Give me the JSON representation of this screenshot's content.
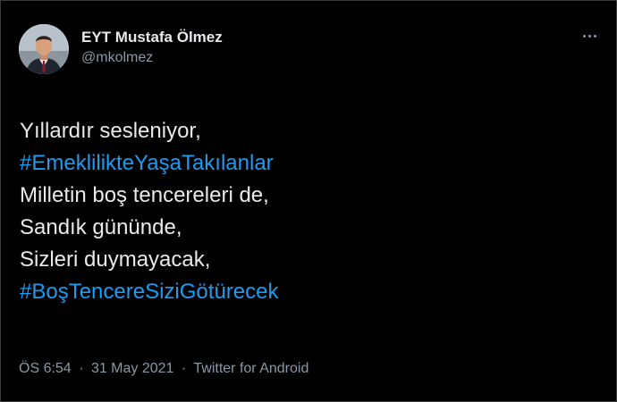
{
  "tweet": {
    "display_name": "EYT Mustafa Ölmez",
    "handle": "@mkolmez",
    "avatar_icon": "profile-photo",
    "more_icon": "more-options-icon",
    "lines": [
      {
        "text": "Yıllardır sesleniyor,",
        "hashtag": false
      },
      {
        "text": "#EmeklilikteYaşaTakılanlar",
        "hashtag": true
      },
      {
        "text": "Milletin boş tencereleri de,",
        "hashtag": false
      },
      {
        "text": "Sandık gününde,",
        "hashtag": false
      },
      {
        "text": "Sizleri duymayacak,",
        "hashtag": false
      },
      {
        "text": "#BoşTencereSiziGötürecek",
        "hashtag": true
      }
    ],
    "time": "ÖS 6:54",
    "date": "31 May 2021",
    "separator": "·",
    "source": "Twitter for Android"
  },
  "colors": {
    "background": "#000000",
    "text": "#e7e9ea",
    "secondary": "#8b98a5",
    "hashtag": "#1d9bf0"
  }
}
